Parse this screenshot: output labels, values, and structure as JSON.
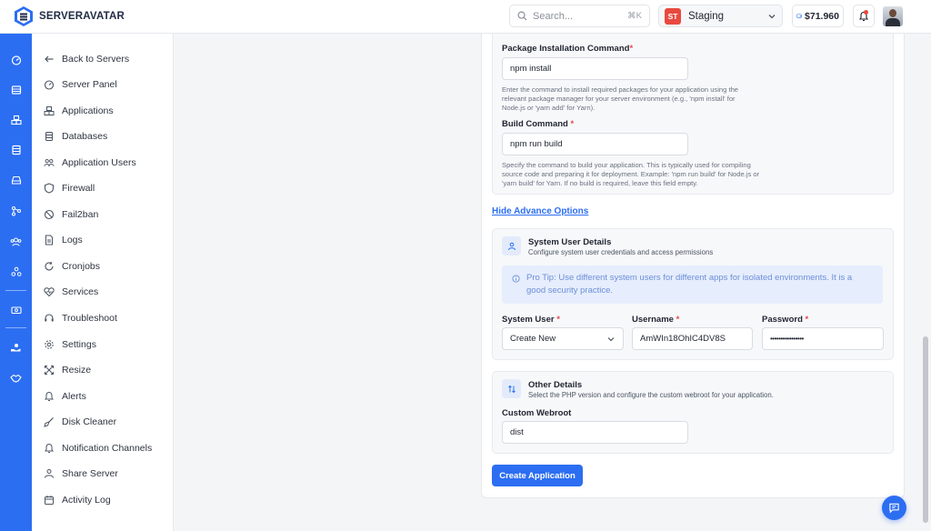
{
  "brand": {
    "name": "SERVERAVATAR",
    "color": "#2c6ef2"
  },
  "header": {
    "search_placeholder": "Search...",
    "search_shortcut": "⌘K",
    "server_badge": "ST",
    "server_name": "Staging",
    "balance": "$71.960"
  },
  "rail_icons": [
    "dashboard-icon",
    "servers-icon",
    "applications-icon",
    "databases-icon",
    "storage-icon",
    "git-icon",
    "team-icon",
    "integrations-icon",
    "billing-icon",
    "hand-icon",
    "handshake-icon"
  ],
  "sidebar": {
    "items": [
      {
        "label": "Back to Servers",
        "icon": "arrow-left-icon"
      },
      {
        "label": "Server Panel",
        "icon": "gauge-icon"
      },
      {
        "label": "Applications",
        "icon": "cubes-icon"
      },
      {
        "label": "Databases",
        "icon": "database-icon"
      },
      {
        "label": "Application Users",
        "icon": "users-icon"
      },
      {
        "label": "Firewall",
        "icon": "shield-icon"
      },
      {
        "label": "Fail2ban",
        "icon": "ban-icon"
      },
      {
        "label": "Logs",
        "icon": "file-icon"
      },
      {
        "label": "Cronjobs",
        "icon": "refresh-icon"
      },
      {
        "label": "Services",
        "icon": "heart-pulse-icon"
      },
      {
        "label": "Troubleshoot",
        "icon": "headset-icon"
      },
      {
        "label": "Settings",
        "icon": "gear-icon"
      },
      {
        "label": "Resize",
        "icon": "resize-icon"
      },
      {
        "label": "Alerts",
        "icon": "bell-icon"
      },
      {
        "label": "Disk Cleaner",
        "icon": "broom-icon"
      },
      {
        "label": "Notification Channels",
        "icon": "bell-outline-icon"
      },
      {
        "label": "Share Server",
        "icon": "share-icon"
      },
      {
        "label": "Activity Log",
        "icon": "calendar-icon"
      }
    ]
  },
  "form": {
    "package_cmd": {
      "label": "Package Installation Command",
      "value": "npm install",
      "help": "Enter the command to install required packages for your application using the relevant package manager for your server environment (e.g., 'npm install' for Node.js or 'yarn add' for Yarn)."
    },
    "build_cmd": {
      "label": "Build Command",
      "value": "npm run build",
      "help": "Specify the command to build your application. This is typically used for compiling source code and preparing it for deployment. Example: 'npm run build' for Node.js or 'yarn build' for Yarn. If no build is required, leave this field empty."
    },
    "hide_advance": "Hide Advance Options",
    "system_user": {
      "title": "System User Details",
      "subtitle": "Configure system user credentials and access permissions",
      "tip": "Pro Tip: Use different system users for different apps for isolated environments. It is a good security practice.",
      "system_user_label": "System User",
      "system_user_value": "Create New",
      "username_label": "Username",
      "username_value": "AmWIn18OhIC4DV8S",
      "password_label": "Password",
      "password_value": "••••••••••••••••"
    },
    "other": {
      "title": "Other Details",
      "subtitle": "Select the PHP version and configure the custom webroot for your application.",
      "webroot_label": "Custom Webroot",
      "webroot_value": "dist"
    },
    "submit": "Create Application",
    "required_mark": "*"
  }
}
